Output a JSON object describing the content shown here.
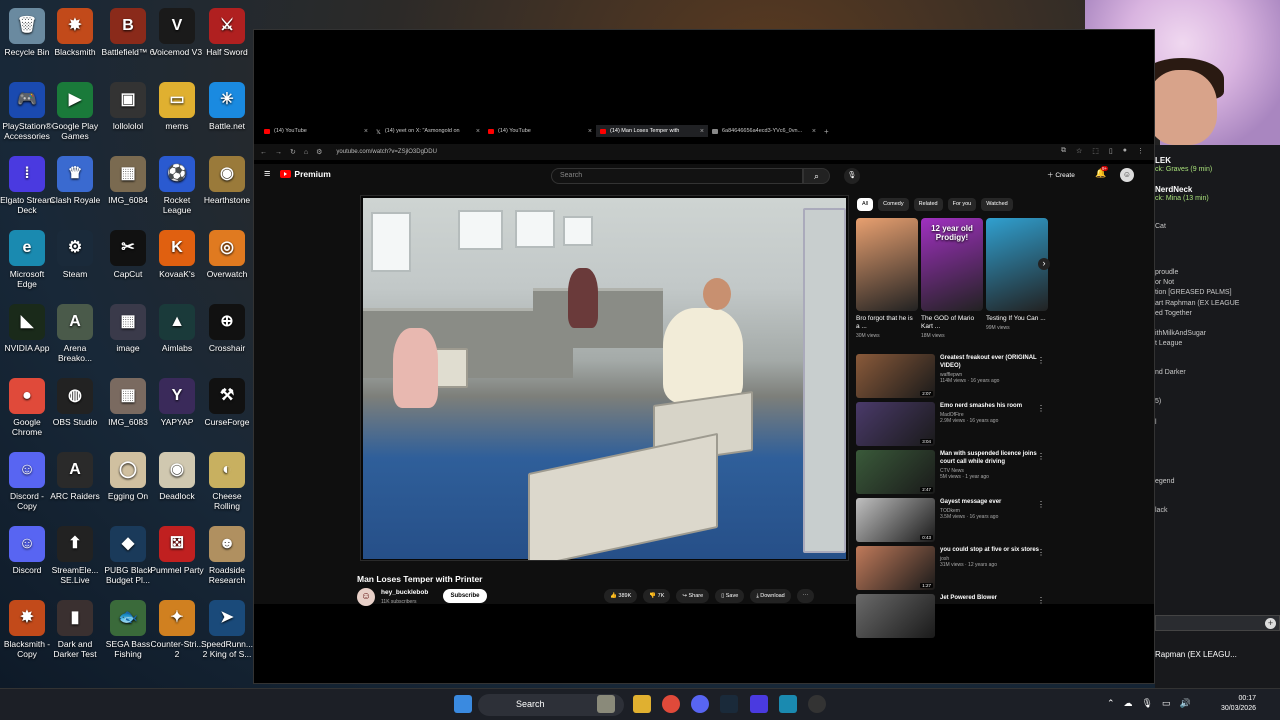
{
  "desktop_icons": [
    {
      "label": "Recycle Bin",
      "icon": "recycle-bin-icon",
      "color": "#6a8aa0",
      "glyph": "🗑"
    },
    {
      "label": "Blacksmith",
      "icon": "blacksmith-icon",
      "color": "#c24a1a",
      "glyph": "✸"
    },
    {
      "label": "Battlefield™ 6",
      "icon": "battlefield-icon",
      "color": "#8a2a1a",
      "glyph": "B"
    },
    {
      "label": "Voicemod V3",
      "icon": "voicemod-icon",
      "color": "#1a1a1a",
      "glyph": "V"
    },
    {
      "label": "Half Sword",
      "icon": "half-sword-icon",
      "color": "#b02020",
      "glyph": "⚔"
    },
    {
      "label": "PlayStation® Accessories",
      "icon": "playstation-icon",
      "color": "#1a4ab0",
      "glyph": "🎮"
    },
    {
      "label": "Google Play Games",
      "icon": "google-play-icon",
      "color": "#1a7a3a",
      "glyph": "▶"
    },
    {
      "label": "lollololol",
      "icon": "folder-icon",
      "color": "#333333",
      "glyph": "▣"
    },
    {
      "label": "mems",
      "icon": "folder-icon",
      "color": "#e0b030",
      "glyph": "▭"
    },
    {
      "label": "Battle.net",
      "icon": "battlenet-icon",
      "color": "#1a8ae0",
      "glyph": "✳"
    },
    {
      "label": "Elgato Stream Deck",
      "icon": "stream-deck-icon",
      "color": "#4a3ae0",
      "glyph": "⁞"
    },
    {
      "label": "Clash Royale",
      "icon": "clash-royale-icon",
      "color": "#3a6ad0",
      "glyph": "♛"
    },
    {
      "label": "IMG_6084",
      "icon": "image-icon",
      "color": "#7a6a50",
      "glyph": "▦"
    },
    {
      "label": "Rocket League",
      "icon": "rocket-league-icon",
      "color": "#2a5ad0",
      "glyph": "⚽"
    },
    {
      "label": "Hearthstone",
      "icon": "hearthstone-icon",
      "color": "#9a7a3a",
      "glyph": "◉"
    },
    {
      "label": "Microsoft Edge",
      "icon": "edge-icon",
      "color": "#1a8ab0",
      "glyph": "e"
    },
    {
      "label": "Steam",
      "icon": "steam-icon",
      "color": "#1a2a3a",
      "glyph": "⚙"
    },
    {
      "label": "CapCut",
      "icon": "capcut-icon",
      "color": "#111111",
      "glyph": "✂"
    },
    {
      "label": "KovaaK's",
      "icon": "kovaaks-icon",
      "color": "#e06010",
      "glyph": "K"
    },
    {
      "label": "Overwatch",
      "icon": "overwatch-icon",
      "color": "#e07a20",
      "glyph": "◎"
    },
    {
      "label": "NVIDIA App",
      "icon": "nvidia-icon",
      "color": "#1a2a1a",
      "glyph": "◣"
    },
    {
      "label": "Arena Breako...",
      "icon": "arena-breakout-icon",
      "color": "#4a5a4a",
      "glyph": "A"
    },
    {
      "label": "image",
      "icon": "image-icon",
      "color": "#3a3a4a",
      "glyph": "▦"
    },
    {
      "label": "Aimlabs",
      "icon": "aimlabs-icon",
      "color": "#1a3a3a",
      "glyph": "▲"
    },
    {
      "label": "Crosshair",
      "icon": "crosshair-icon",
      "color": "#111111",
      "glyph": "⊕"
    },
    {
      "label": "Google Chrome",
      "icon": "chrome-icon",
      "color": "#e04a3a",
      "glyph": "●"
    },
    {
      "label": "OBS Studio",
      "icon": "obs-icon",
      "color": "#222222",
      "glyph": "◍"
    },
    {
      "label": "IMG_6083",
      "icon": "image-icon",
      "color": "#7a6a60",
      "glyph": "▦"
    },
    {
      "label": "YAPYAP",
      "icon": "yapyap-icon",
      "color": "#3a2a5a",
      "glyph": "Y"
    },
    {
      "label": "CurseForge",
      "icon": "curseforge-icon",
      "color": "#111111",
      "glyph": "⚒"
    },
    {
      "label": "Discord - Copy",
      "icon": "discord-icon",
      "color": "#5865f2",
      "glyph": "☺"
    },
    {
      "label": "ARC Raiders",
      "icon": "arc-raiders-icon",
      "color": "#2a2a2a",
      "glyph": "A"
    },
    {
      "label": "Egging On",
      "icon": "egging-on-icon",
      "color": "#d0c0a0",
      "glyph": "◯"
    },
    {
      "label": "Deadlock",
      "icon": "deadlock-icon",
      "color": "#d0c8b0",
      "glyph": "◉"
    },
    {
      "label": "Cheese Rolling",
      "icon": "cheese-rolling-icon",
      "color": "#c8b060",
      "glyph": "◐"
    },
    {
      "label": "Discord",
      "icon": "discord-icon",
      "color": "#5865f2",
      "glyph": "☺"
    },
    {
      "label": "StreamEle... SE.Live",
      "icon": "streamelements-icon",
      "color": "#222222",
      "glyph": "⬆"
    },
    {
      "label": "PUBG Black Budget Pl...",
      "icon": "pubg-icon",
      "color": "#1a3a5a",
      "glyph": "◆"
    },
    {
      "label": "Pummel Party",
      "icon": "pummel-party-icon",
      "color": "#c02020",
      "glyph": "⚄"
    },
    {
      "label": "Roadside Research",
      "icon": "roadside-research-icon",
      "color": "#b09060",
      "glyph": "☻"
    },
    {
      "label": "Blacksmith - Copy",
      "icon": "blacksmith-icon",
      "color": "#c24a1a",
      "glyph": "✸"
    },
    {
      "label": "Dark and Darker Test",
      "icon": "dark-and-darker-icon",
      "color": "#3a3030",
      "glyph": "▮"
    },
    {
      "label": "SEGA Bass Fishing",
      "icon": "sega-bass-fishing-icon",
      "color": "#3a6a3a",
      "glyph": "🐟"
    },
    {
      "label": "Counter-Stri... 2",
      "icon": "counter-strike-icon",
      "color": "#d08020",
      "glyph": "✦"
    },
    {
      "label": "SpeedRunn... 2 King of S...",
      "icon": "speedrunners-icon",
      "color": "#1a4a7a",
      "glyph": "➤"
    }
  ],
  "browser": {
    "tabs": [
      {
        "title": "(14) YouTube",
        "fav": "youtube"
      },
      {
        "title": "(14) yeet on X: \"Asmongold on",
        "fav": "x"
      },
      {
        "title": "(14) YouTube",
        "fav": "youtube"
      },
      {
        "title": "(14) Man Loses Temper with",
        "fav": "youtube",
        "active": true
      },
      {
        "title": "6a84646656a4ecd3-YVc6_0vn...",
        "fav": "doc"
      }
    ],
    "url": "youtube.com/watch?v=ZSjlO3DgDDU"
  },
  "youtube": {
    "logo_text": "Premium",
    "search_placeholder": "Search",
    "create_label": "Create",
    "notif_count": "9+",
    "video_title": "Man Loses Temper with Printer",
    "channel_name": "hey_bucklebob",
    "channel_subs": "11K subscribers",
    "subscribe_label": "Subscribe",
    "likes": "389K",
    "dislikes": "7K",
    "share_label": "Share",
    "save_label": "Save",
    "download_label": "Download",
    "chips": [
      "All",
      "Comedy",
      "Related",
      "For you",
      "Watched"
    ],
    "shorts": [
      {
        "title": "Bro forgot that he is a ...",
        "views": "30M views",
        "overlay": "",
        "color": "#e8a070"
      },
      {
        "title": "The GOD of Mario Kart ...",
        "views": "18M views",
        "overlay": "12 year old Prodigy!",
        "color": "#a030c0"
      },
      {
        "title": "Testing If You Can ...",
        "views": "99M views",
        "overlay": "",
        "color": "#30a0d0"
      }
    ],
    "related": [
      {
        "title": "Greatest freakout ever (ORIGINAL VIDEO)",
        "channel": "wafflepwn",
        "meta": "114M views · 16 years ago",
        "duration": "2:07",
        "color": "#8a5a3a"
      },
      {
        "title": "Emo nerd smashes his room",
        "channel": "MadOfFire",
        "meta": "2.9M views · 16 years ago",
        "duration": "3:04",
        "color": "#4a3a6a"
      },
      {
        "title": "Man with suspended licence joins court call while driving",
        "channel": "CTV News",
        "meta": "5M views · 1 year ago",
        "duration": "2:47",
        "color": "#3a5a3a"
      },
      {
        "title": "Gayest message ever",
        "channel": "TODkem",
        "meta": "3.5M views · 16 years ago",
        "duration": "0:43",
        "color": "#c0c0c0"
      },
      {
        "title": "you could stop at five or six stores",
        "channel": "josh",
        "meta": "31M views · 12 years ago",
        "duration": "1:27",
        "color": "#c07a5a"
      },
      {
        "title": "Jet Powered Blower",
        "channel": "",
        "meta": "",
        "duration": "",
        "color": "#6a6a6a"
      }
    ]
  },
  "chat": {
    "lines": [
      {
        "text": "LEK",
        "bold": true
      },
      {
        "text": "ck: Graves (9 min)",
        "green": true
      },
      {
        "text": "NerdNeck",
        "bold": true
      },
      {
        "text": "ck: Mina (13 min)",
        "green": true
      },
      {
        "text": "Cat"
      },
      {
        "text": "proudle"
      },
      {
        "text": "or Not"
      },
      {
        "text": "tion [GREASED PALMS]"
      },
      {
        "text": "art Raphman (EX LEAGUE"
      },
      {
        "text": "ed Together"
      },
      {
        "text": "ithMilkAndSugar"
      },
      {
        "text": "t League"
      },
      {
        "text": "nd Darker"
      },
      {
        "text": "5)"
      },
      {
        "text": "l"
      },
      {
        "text": "egend"
      },
      {
        "text": "lack"
      }
    ],
    "bottom": "Rapman (EX LEAGU..."
  },
  "taskbar": {
    "search_label": "Search",
    "time": "00:17",
    "date": "30/03/2026"
  }
}
